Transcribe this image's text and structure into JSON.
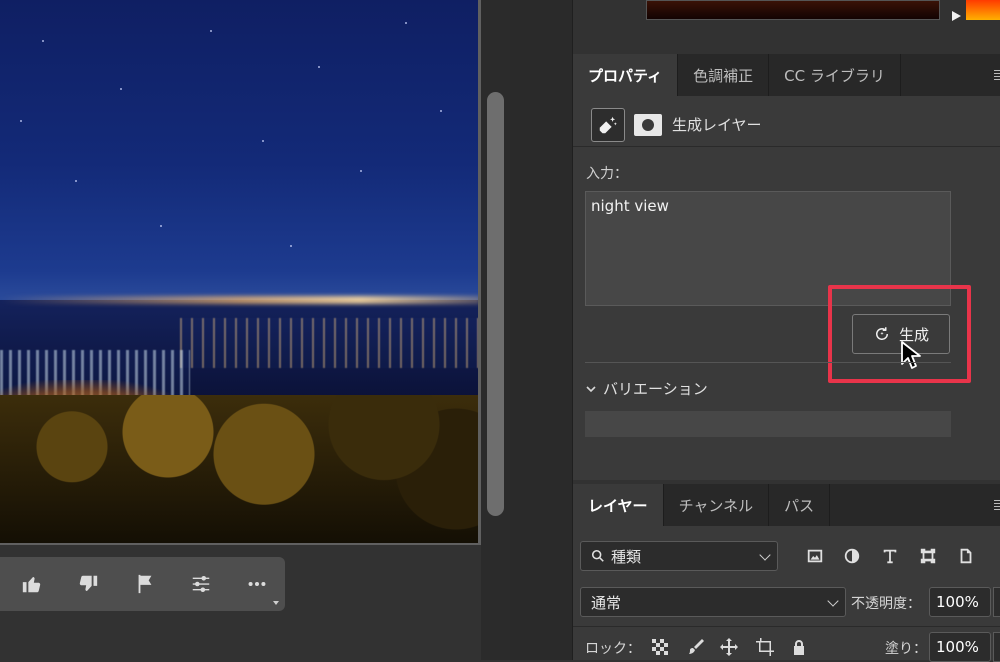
{
  "properties_panel": {
    "tabs": [
      {
        "label": "プロパティ",
        "active": true
      },
      {
        "label": "色調補正",
        "active": false
      },
      {
        "label": "CC ライブラリ",
        "active": false
      }
    ],
    "layer_type_label": "生成レイヤー",
    "input_label": "入力：",
    "prompt_value": "night view",
    "generate_button_label": "生成",
    "variations_label": "バリエーション"
  },
  "layers_panel": {
    "tabs": [
      {
        "label": "レイヤー",
        "active": true
      },
      {
        "label": "チャンネル",
        "active": false
      },
      {
        "label": "パス",
        "active": false
      }
    ],
    "kind_filter_value": "種類",
    "blend_mode_value": "通常",
    "opacity_label": "不透明度：",
    "opacity_value": "100%",
    "lock_label": "ロック：",
    "fill_label": "塗り：",
    "fill_value": "100%"
  },
  "feedback_toolbar": {
    "icons": [
      "thumbs-up-icon",
      "thumbs-down-icon",
      "flag-icon",
      "sliders-icon",
      "more-icon"
    ]
  },
  "colors": {
    "highlight": "#e8344a",
    "panel_bg": "#3a3a3a",
    "tabbar_bg": "#282828"
  }
}
